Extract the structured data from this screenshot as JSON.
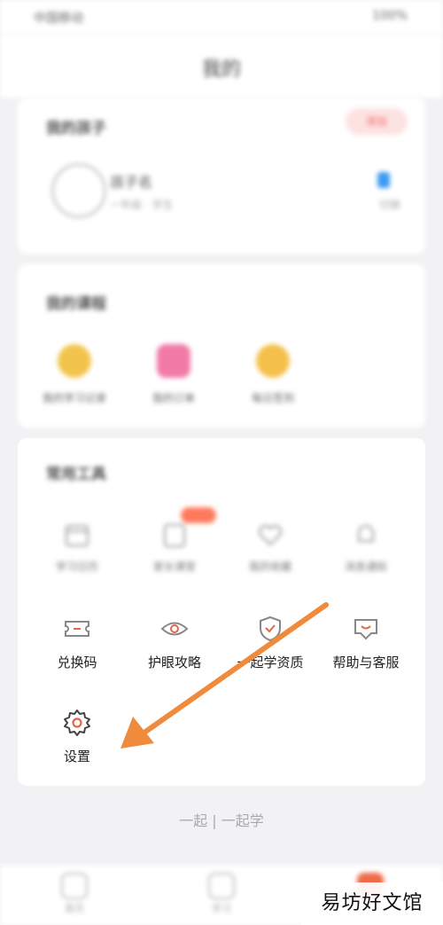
{
  "status_bar": {
    "left": "中国移动",
    "right": "100%"
  },
  "header": {
    "title": "我的"
  },
  "child_card": {
    "title": "我的孩子",
    "tag": "添加",
    "name": "孩子名",
    "subtitle": "一年级 · 学生",
    "switch_label": "切换"
  },
  "course_card": {
    "title": "我的课程",
    "items": [
      {
        "label": "我的学习记录",
        "color": "#f2c44b"
      },
      {
        "label": "我的订单",
        "color": "#f17ba6"
      },
      {
        "label": "每日签到",
        "color": "#f4c04a"
      }
    ]
  },
  "tools_card": {
    "title": "常用工具",
    "row1": [
      {
        "label": "学习日历"
      },
      {
        "label": "家长课堂"
      },
      {
        "label": "我的收藏"
      },
      {
        "label": "消息通知"
      }
    ],
    "row2": [
      {
        "label": "兑换码"
      },
      {
        "label": "护眼攻略"
      },
      {
        "label": "一起学资质"
      },
      {
        "label": "帮助与客服"
      }
    ],
    "settings": {
      "label": "设置"
    }
  },
  "brand": {
    "text": "一起 | 一起学"
  },
  "tabbar": {
    "tabs": [
      {
        "label": "首页"
      },
      {
        "label": "学习"
      },
      {
        "label": "我的"
      }
    ]
  },
  "watermark": {
    "text": "易坊好文馆"
  },
  "colors": {
    "accent": "#f08a3c",
    "badge": "#ff7a5c"
  }
}
